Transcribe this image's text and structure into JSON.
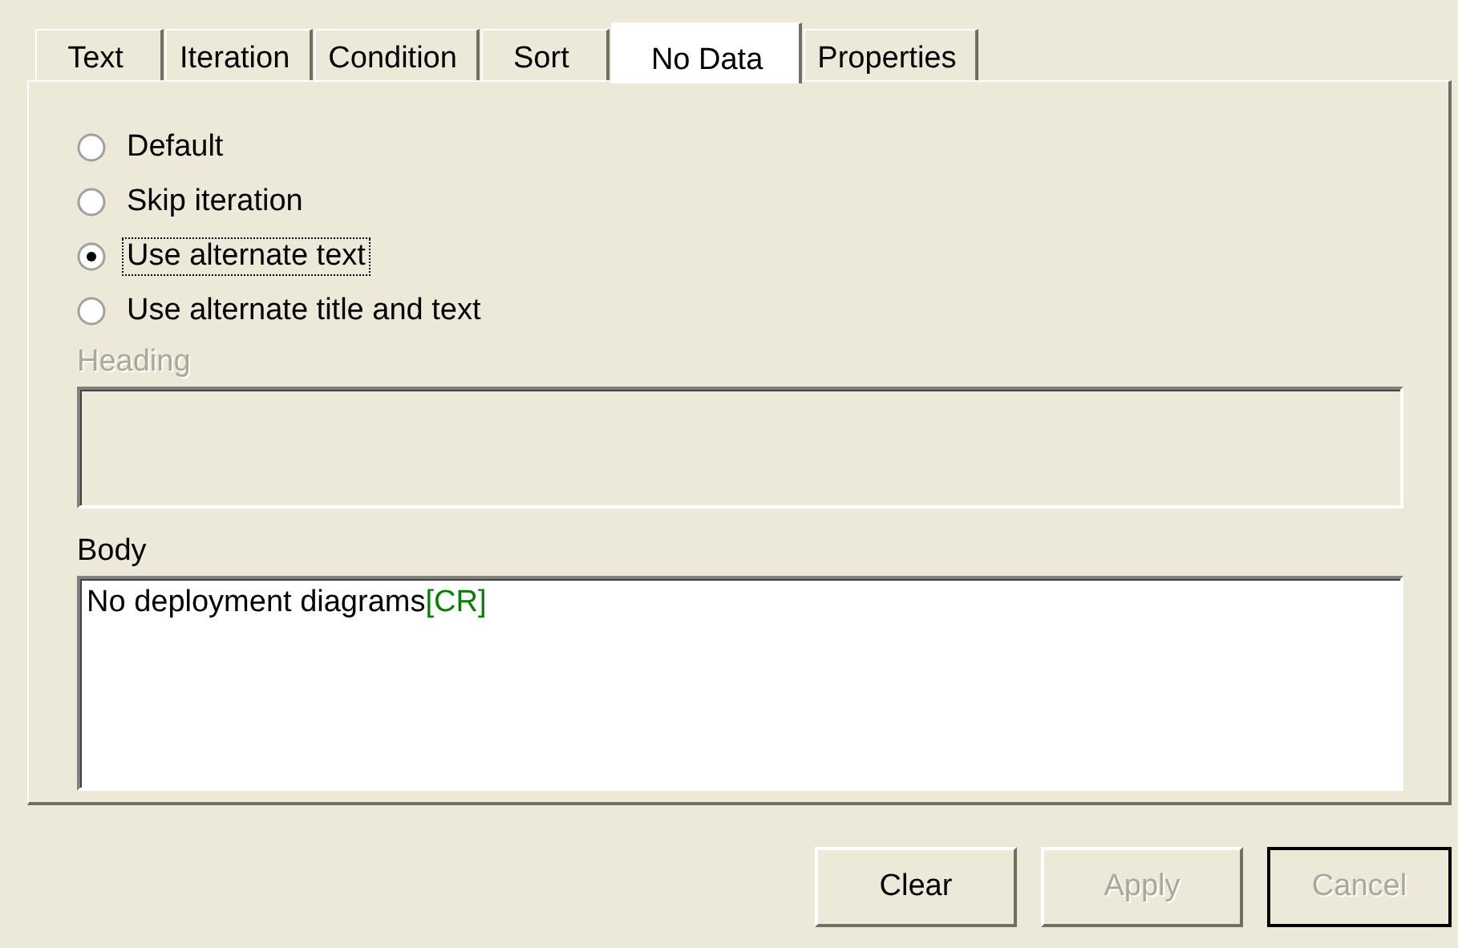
{
  "tabs": [
    {
      "label": "Text",
      "selected": false
    },
    {
      "label": "Iteration",
      "selected": false
    },
    {
      "label": "Condition",
      "selected": false
    },
    {
      "label": "Sort",
      "selected": false
    },
    {
      "label": "No Data",
      "selected": true
    },
    {
      "label": "Properties",
      "selected": false
    }
  ],
  "options": [
    {
      "label": "Default",
      "selected": false,
      "focused": false
    },
    {
      "label": "Skip iteration",
      "selected": false,
      "focused": false
    },
    {
      "label": "Use alternate text",
      "selected": true,
      "focused": true
    },
    {
      "label": "Use alternate title and text",
      "selected": false,
      "focused": false
    }
  ],
  "heading": {
    "label": "Heading",
    "disabled": true
  },
  "body": {
    "label": "Body",
    "disabled": false,
    "segments": [
      {
        "text": "No deployment diagrams",
        "kind": "plain"
      },
      {
        "text": "[CR]",
        "kind": "code"
      }
    ]
  },
  "buttons": [
    {
      "label": "Clear",
      "disabled": false,
      "default": false
    },
    {
      "label": "Apply",
      "disabled": true,
      "default": false
    },
    {
      "label": "Cancel",
      "disabled": true,
      "default": true
    }
  ]
}
